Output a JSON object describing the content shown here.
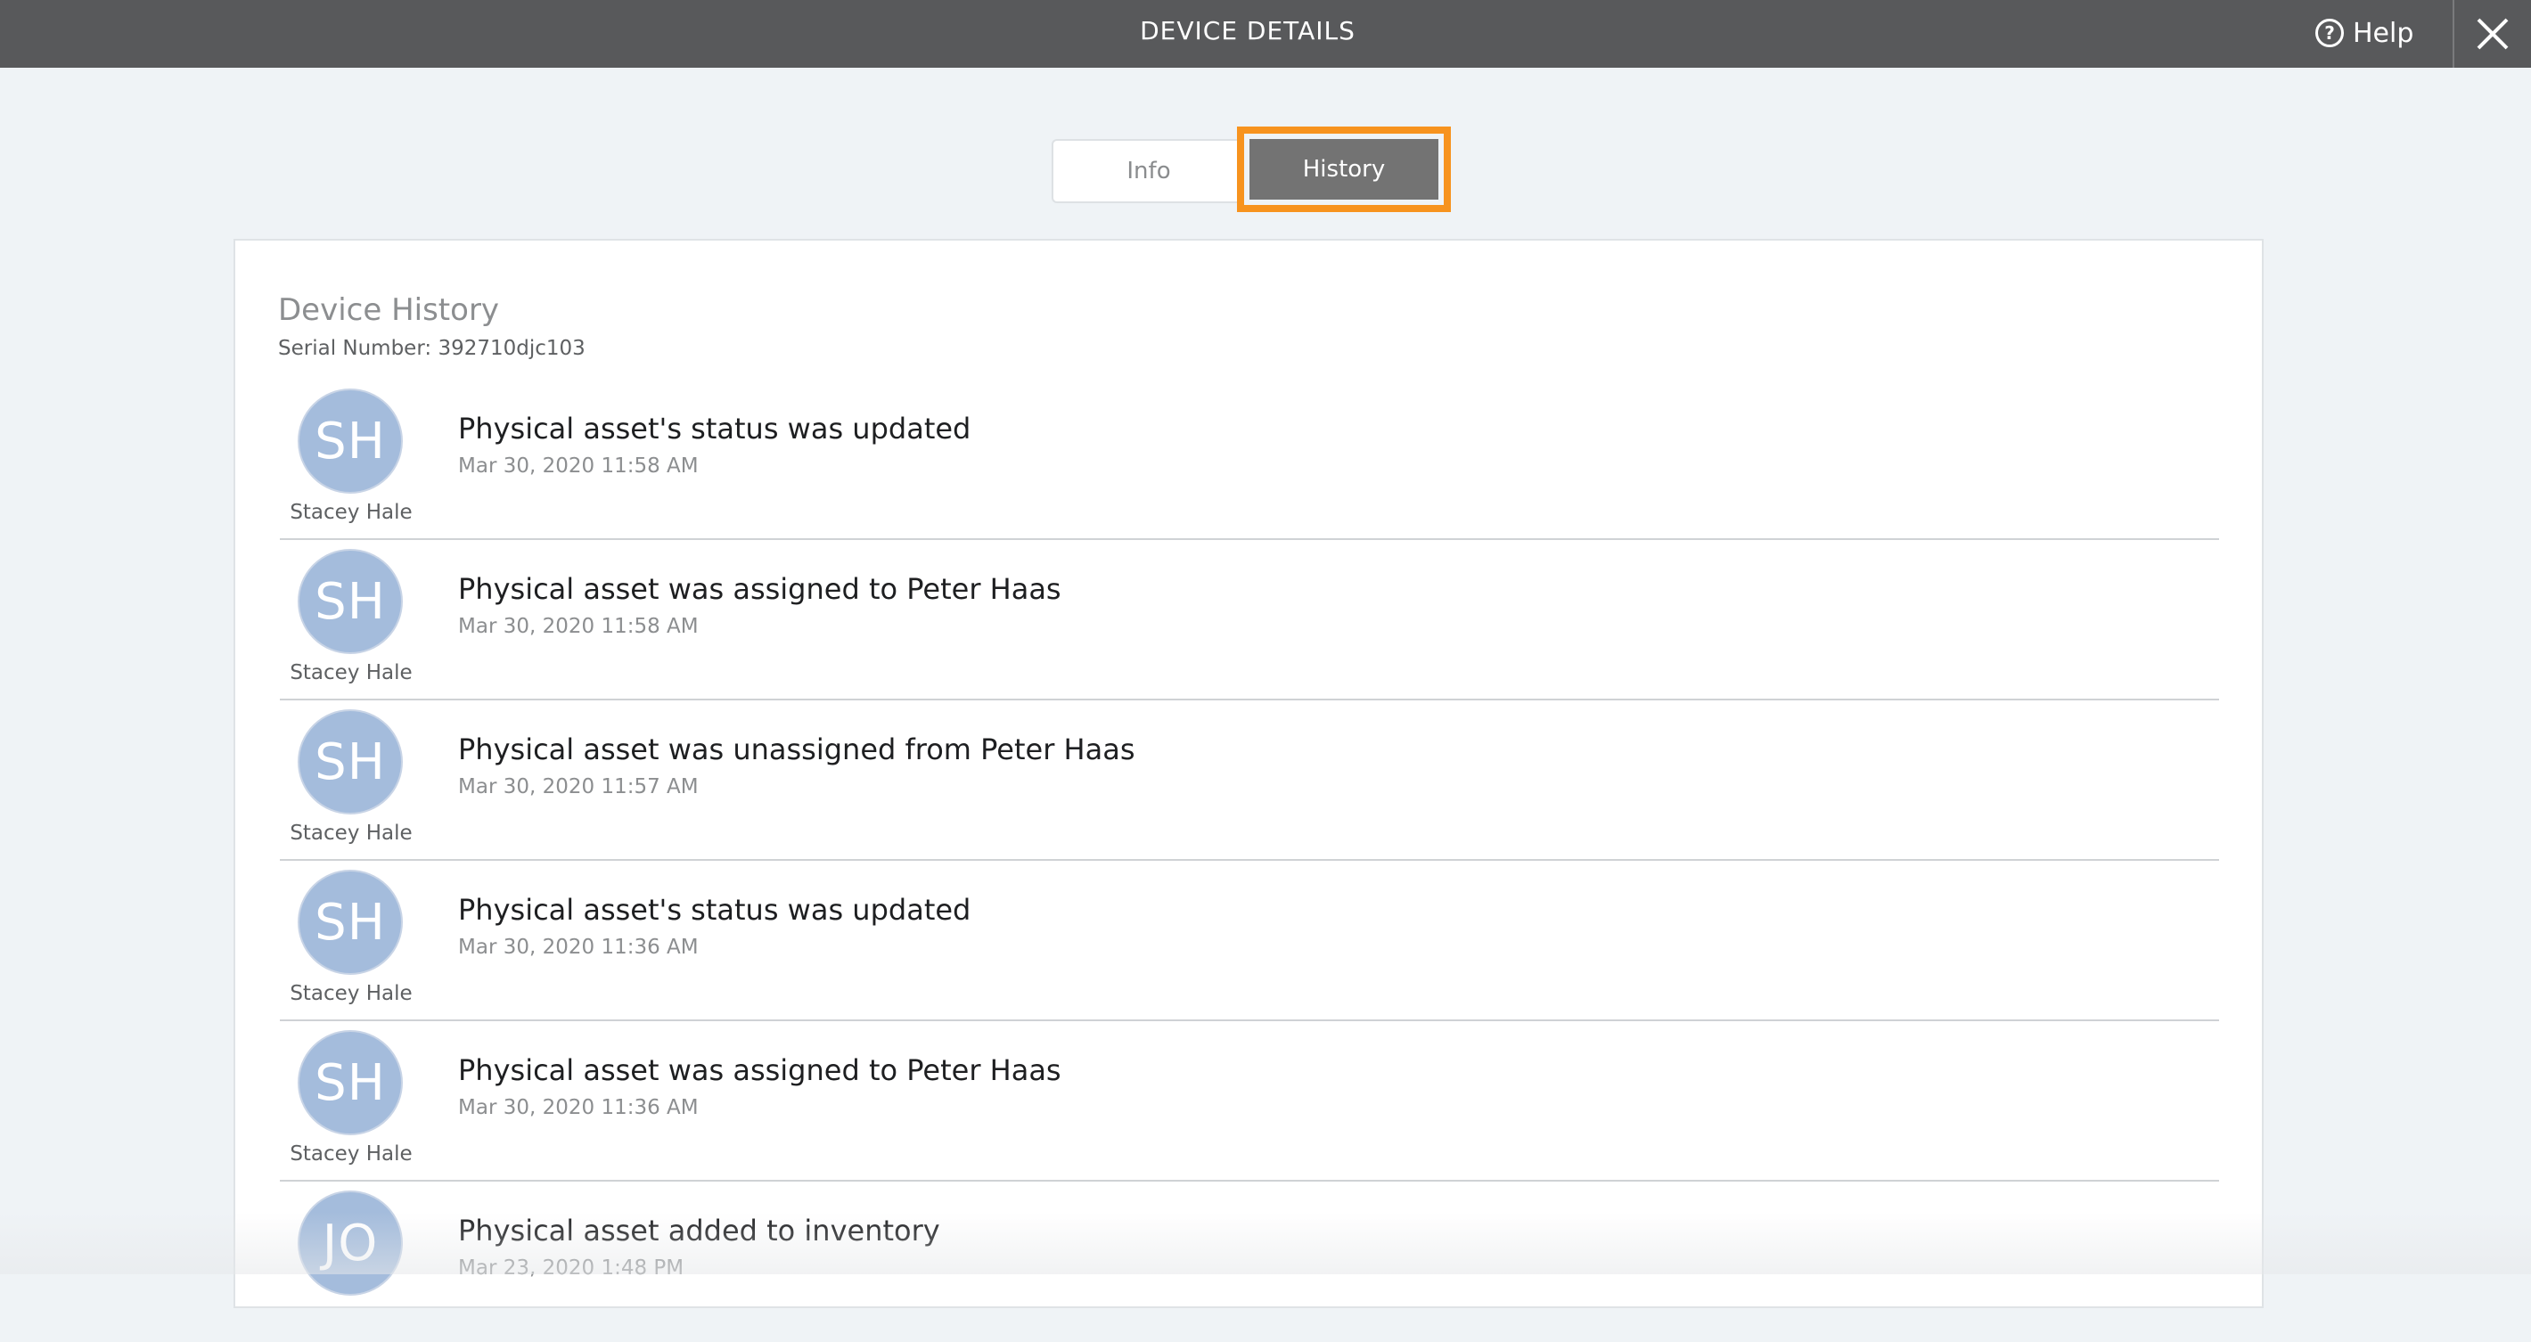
{
  "header": {
    "title": "DEVICE DETAILS",
    "help_label": "Help",
    "help_icon": "question-circle-icon",
    "close_icon": "close-icon"
  },
  "tabs": [
    {
      "label": "Info",
      "active": false
    },
    {
      "label": "History",
      "active": true
    }
  ],
  "history": {
    "title": "Device History",
    "serial": "Serial Number: 392710djc103",
    "items": [
      {
        "initials": "SH",
        "author": "Stacey Hale",
        "text": "Physical asset's status was updated",
        "time": "Mar 30, 2020 11:58 AM"
      },
      {
        "initials": "SH",
        "author": "Stacey Hale",
        "text": "Physical asset was assigned to Peter Haas",
        "time": "Mar 30, 2020 11:58 AM"
      },
      {
        "initials": "SH",
        "author": "Stacey Hale",
        "text": "Physical asset was unassigned from Peter Haas",
        "time": "Mar 30, 2020 11:57 AM"
      },
      {
        "initials": "SH",
        "author": "Stacey Hale",
        "text": "Physical asset's status was updated",
        "time": "Mar 30, 2020 11:36 AM"
      },
      {
        "initials": "SH",
        "author": "Stacey Hale",
        "text": "Physical asset was assigned to Peter Haas",
        "time": "Mar 30, 2020 11:36 AM"
      },
      {
        "initials": "JO",
        "author": "",
        "text": "Physical asset added to inventory",
        "time": "Mar 23, 2020 1:48 PM"
      }
    ]
  },
  "colors": {
    "topbar": "#58595b",
    "highlight": "#f7931e",
    "active_tab": "#737373",
    "avatar": "#a4bcdc"
  }
}
